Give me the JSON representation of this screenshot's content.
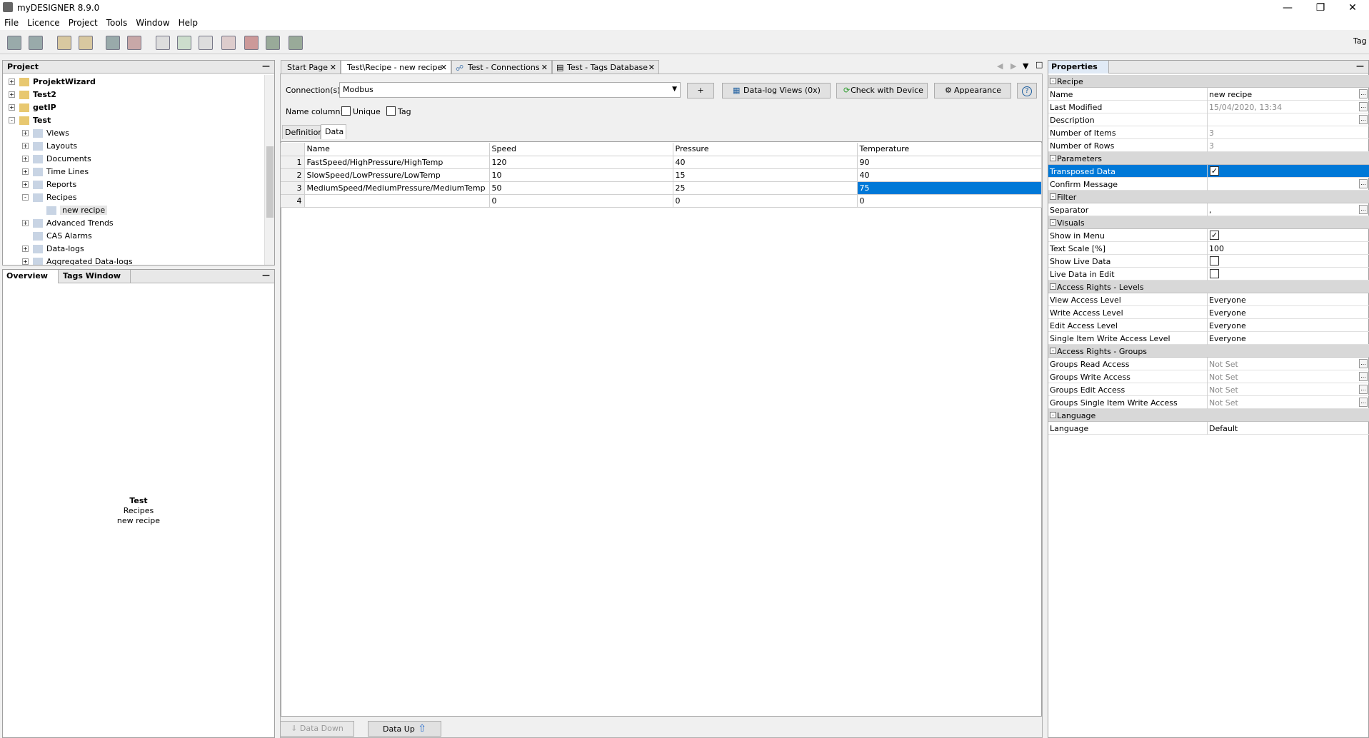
{
  "app": {
    "title": "myDESIGNER 8.9.0"
  },
  "menu": [
    "File",
    "Licence",
    "Project",
    "Tools",
    "Window",
    "Help"
  ],
  "toolbar": {
    "right_label": "Tag"
  },
  "project_panel": {
    "title": "Project",
    "tree": [
      {
        "label": "ProjektWizard",
        "bold": true,
        "level": 0,
        "expand": "+"
      },
      {
        "label": "Test2",
        "bold": true,
        "level": 0,
        "expand": "+"
      },
      {
        "label": "getIP",
        "bold": true,
        "level": 0,
        "expand": "+"
      },
      {
        "label": "Test",
        "bold": true,
        "level": 0,
        "expand": "-"
      },
      {
        "label": "Views",
        "level": 1,
        "expand": "+"
      },
      {
        "label": "Layouts",
        "level": 1,
        "expand": "+"
      },
      {
        "label": "Documents",
        "level": 1,
        "expand": "+"
      },
      {
        "label": "Time Lines",
        "level": 1,
        "expand": "+"
      },
      {
        "label": "Reports",
        "level": 1,
        "expand": "+"
      },
      {
        "label": "Recipes",
        "level": 1,
        "expand": "-"
      },
      {
        "label": "new recipe",
        "level": 2,
        "selected": true
      },
      {
        "label": "Advanced Trends",
        "level": 1,
        "expand": "+"
      },
      {
        "label": "CAS Alarms",
        "level": 1
      },
      {
        "label": "Data-logs",
        "level": 1,
        "expand": "+"
      },
      {
        "label": "Aggregated Data-logs",
        "level": 1,
        "expand": "+"
      }
    ]
  },
  "overview_panel": {
    "tabs": [
      "Overview",
      "Tags Window"
    ],
    "title": "Test",
    "line2": "Recipes",
    "line3": "new recipe"
  },
  "editor": {
    "tabs": [
      "Start Page",
      "Test\\Recipe - new recipe",
      "Test - Connections",
      "Test - Tags Database"
    ],
    "connection_label": "Connection(s):",
    "connection_value": "Modbus",
    "add_label": "+",
    "datalog_label": "Data-log Views (0x)",
    "check_label": "Check with Device",
    "appearance_label": "Appearance",
    "help_label": "?",
    "name_column_label": "Name column:",
    "unique_label": "Unique",
    "tag_label": "Tag",
    "subtabs": [
      "Definition",
      "Data"
    ],
    "grid": {
      "columns": [
        "Name",
        "Speed",
        "Pressure",
        "Temperature"
      ],
      "rows": [
        {
          "n": "1",
          "cells": [
            "FastSpeed/HighPressure/HighTemp",
            "120",
            "40",
            "90"
          ]
        },
        {
          "n": "2",
          "cells": [
            "SlowSpeed/LowPressure/LowTemp",
            "10",
            "15",
            "40"
          ]
        },
        {
          "n": "3",
          "cells": [
            "MediumSpeed/MediumPressure/MediumTemp",
            "50",
            "25",
            "75"
          ]
        },
        {
          "n": "4",
          "cells": [
            "",
            "0",
            "0",
            "0"
          ]
        }
      ]
    },
    "data_down_label": "Data Down",
    "data_up_label": "Data Up"
  },
  "properties": {
    "title": "Properties",
    "sections": [
      {
        "cat": "Recipe",
        "rows": [
          {
            "k": "Name",
            "v": "new recipe",
            "dots": true
          },
          {
            "k": "Last Modified",
            "v": "15/04/2020, 13:34",
            "gray": true,
            "dots": true
          },
          {
            "k": "Description",
            "v": "",
            "dots": true
          },
          {
            "k": "Number of Items",
            "v": "3",
            "gray": true
          },
          {
            "k": "Number of Rows",
            "v": "3",
            "gray": true
          }
        ]
      },
      {
        "cat": "Parameters",
        "rows": [
          {
            "k": "Transposed Data",
            "check": true,
            "checked": true,
            "selected": true
          },
          {
            "k": "Confirm Message",
            "v": "",
            "dots": true
          }
        ]
      },
      {
        "cat": "Filter",
        "rows": [
          {
            "k": "Separator",
            "v": ",",
            "dots": true
          }
        ]
      },
      {
        "cat": "Visuals",
        "rows": [
          {
            "k": "Show in Menu",
            "check": true,
            "checked": true
          },
          {
            "k": "Text Scale [%]",
            "v": "100"
          },
          {
            "k": "Show Live Data",
            "check": true,
            "checked": false
          },
          {
            "k": "Live Data in Edit",
            "check": true,
            "checked": false
          }
        ]
      },
      {
        "cat": "Access Rights - Levels",
        "rows": [
          {
            "k": "View Access Level",
            "v": "Everyone"
          },
          {
            "k": "Write Access Level",
            "v": "Everyone"
          },
          {
            "k": "Edit Access Level",
            "v": "Everyone"
          },
          {
            "k": "Single Item Write Access Level",
            "v": "Everyone"
          }
        ]
      },
      {
        "cat": "Access Rights - Groups",
        "rows": [
          {
            "k": "Groups Read Access",
            "v": "Not Set",
            "gray": true,
            "dots": true
          },
          {
            "k": "Groups Write Access",
            "v": "Not Set",
            "gray": true,
            "dots": true
          },
          {
            "k": "Groups Edit Access",
            "v": "Not Set",
            "gray": true,
            "dots": true
          },
          {
            "k": "Groups Single Item Write Access",
            "v": "Not Set",
            "gray": true,
            "dots": true
          }
        ]
      },
      {
        "cat": "Language",
        "rows": [
          {
            "k": "Language",
            "v": "Default"
          }
        ]
      }
    ]
  },
  "colors": {
    "selection": "#0078d7",
    "tree_selected": "#e5e5e5"
  }
}
